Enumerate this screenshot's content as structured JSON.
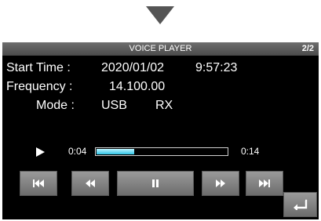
{
  "header": {
    "title": "VOICE PLAYER",
    "page": "2/2"
  },
  "info": {
    "start_time": {
      "label": "Start Time :",
      "date": "2020/01/02",
      "time": "9:57:23"
    },
    "frequency": {
      "label": "Frequency :",
      "value": "14.100.00"
    },
    "mode": {
      "label": "Mode :",
      "value": "USB",
      "direction": "RX"
    }
  },
  "playback": {
    "elapsed": "0:04",
    "total": "0:14",
    "progress": 0.29,
    "accent_color": "#2fc4e6"
  },
  "controls": {
    "buttons": [
      {
        "icon": "skip-to-start-icon"
      },
      {
        "icon": "rewind-icon"
      },
      {
        "icon": "pause-icon"
      },
      {
        "icon": "fast-forward-icon"
      },
      {
        "icon": "skip-to-end-icon"
      }
    ],
    "return_icon": "return-icon"
  },
  "colors": {
    "background": "#000000",
    "title_bar": "#5a5a5a",
    "button": "#8a8a8a",
    "text": "#ffffff"
  }
}
